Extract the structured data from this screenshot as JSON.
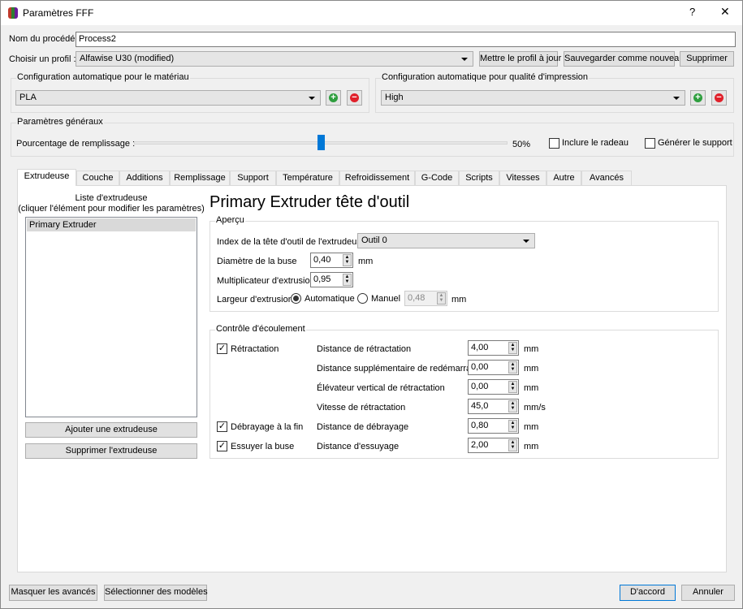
{
  "window": {
    "title": "Paramètres FFF",
    "help": "?",
    "close": "✕"
  },
  "process": {
    "label": "Nom du procédé :",
    "value": "Process2"
  },
  "profile": {
    "label": "Choisir un profil :",
    "value": "Alfawise U30 (modified)",
    "update": "Mettre le profil à jour",
    "save_new": "Sauvegarder comme nouveau",
    "delete": "Supprimer"
  },
  "material": {
    "title": "Configuration automatique pour le matériau",
    "value": "PLA"
  },
  "quality": {
    "title": "Configuration automatique pour qualité d'impression",
    "value": "High"
  },
  "general": {
    "title": "Paramètres généraux",
    "infill_label": "Pourcentage de remplissage :",
    "infill_value": "50%",
    "infill_fraction": 0.5,
    "raft": "Inclure le radeau",
    "support": "Générer le support"
  },
  "tabs": [
    "Extrudeuse",
    "Couche",
    "Additions",
    "Remplissage",
    "Support",
    "Température",
    "Refroidissement",
    "G-Code",
    "Scripts",
    "Vitesses",
    "Autre",
    "Avancés"
  ],
  "extruders": {
    "title1": "Liste d'extrudeuse",
    "title2": "(cliquer l'élément pour modifier les paramètres)",
    "items": [
      "Primary Extruder"
    ],
    "add": "Ajouter une extrudeuse",
    "remove": "Supprimer l'extrudeuse"
  },
  "heading": "Primary Extruder tête d'outil",
  "overview": {
    "title": "Aperçu",
    "index_label": "Index de la tête d'outil de l'extrudeuse",
    "index_value": "Outil 0",
    "diam_label": "Diamètre de la buse",
    "diam_value": "0,40",
    "mult_label": "Multiplicateur d'extrusion",
    "mult_value": "0,95",
    "width_label": "Largeur d'extrusion",
    "auto": "Automatique",
    "manual": "Manuel",
    "manual_value": "0,48",
    "mm": "mm"
  },
  "flow": {
    "title": "Contrôle d'écoulement",
    "retraction": "Rétractation",
    "coast": "Débrayage à la fin",
    "wipe": "Essuyer la buse",
    "rows": [
      {
        "label": "Distance de rétractation",
        "value": "4,00",
        "unit": "mm"
      },
      {
        "label": "Distance supplémentaire de redémarrage",
        "value": "0,00",
        "unit": "mm"
      },
      {
        "label": "Élévateur vertical de rétractation",
        "value": "0,00",
        "unit": "mm"
      },
      {
        "label": "Vitesse de rétractation",
        "value": "45,0",
        "unit": "mm/s"
      },
      {
        "label": "Distance de débrayage",
        "value": "0,80",
        "unit": "mm"
      },
      {
        "label": "Distance d'essuyage",
        "value": "2,00",
        "unit": "mm"
      }
    ]
  },
  "footer": {
    "hide": "Masquer les avancés",
    "select": "Sélectionner des modèles",
    "ok": "D'accord",
    "cancel": "Annuler"
  }
}
